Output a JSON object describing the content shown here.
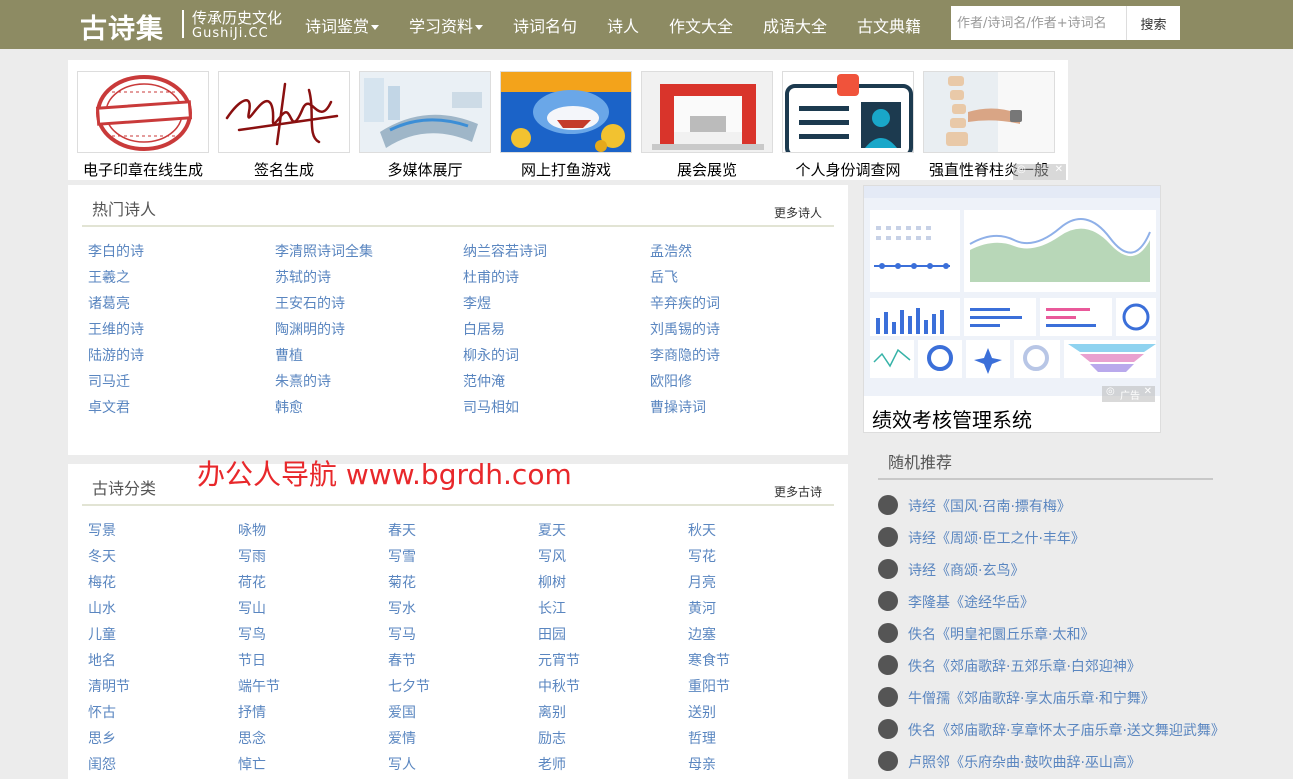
{
  "header": {
    "logo": "古诗集",
    "slogan": "传承历史文化",
    "domain": "GushiJi.CC",
    "nav": [
      "诗词鉴赏",
      "学习资料",
      "诗词名句",
      "诗人",
      "作文大全",
      "成语大全",
      "古文典籍"
    ],
    "search_placeholder": "作者/诗词名/作者+诗词名",
    "search_button": "搜索"
  },
  "ads": {
    "tiles": [
      "电子印章在线生成",
      "签名生成",
      "多媒体展厅",
      "网上打鱼游戏",
      "展会展览",
      "个人身份调查网",
      "强直性脊柱炎一般"
    ],
    "mark_label": "广告",
    "side_caption": "绩效考核管理系统"
  },
  "poets": {
    "title": "热门诗人",
    "more": "更多诗人",
    "items": [
      "李白的诗",
      "李清照诗词全集",
      "纳兰容若诗词",
      "孟浩然",
      "王羲之",
      "苏轼的诗",
      "杜甫的诗",
      "岳飞",
      "诸葛亮",
      "王安石的诗",
      "李煜",
      "辛弃疾的词",
      "王维的诗",
      "陶渊明的诗",
      "白居易",
      "刘禹锡的诗",
      "陆游的诗",
      "曹植",
      "柳永的词",
      "李商隐的诗",
      "司马迁",
      "朱熹的诗",
      "范仲淹",
      "欧阳修",
      "卓文君",
      "韩愈",
      "司马相如",
      "曹操诗词"
    ]
  },
  "categories": {
    "title": "古诗分类",
    "more": "更多古诗",
    "items": [
      "写景",
      "咏物",
      "春天",
      "夏天",
      "秋天",
      "冬天",
      "写雨",
      "写雪",
      "写风",
      "写花",
      "梅花",
      "荷花",
      "菊花",
      "柳树",
      "月亮",
      "山水",
      "写山",
      "写水",
      "长江",
      "黄河",
      "儿童",
      "写鸟",
      "写马",
      "田园",
      "边塞",
      "地名",
      "节日",
      "春节",
      "元宵节",
      "寒食节",
      "清明节",
      "端午节",
      "七夕节",
      "中秋节",
      "重阳节",
      "怀古",
      "抒情",
      "爱国",
      "离别",
      "送别",
      "思乡",
      "思念",
      "爱情",
      "励志",
      "哲理",
      "闺怨",
      "悼亡",
      "写人",
      "老师",
      "母亲"
    ]
  },
  "watermark": "办公人导航  www.bgrdh.com",
  "random": {
    "title": "随机推荐",
    "items": [
      "诗经《国风·召南·摽有梅》",
      "诗经《周颂·臣工之什·丰年》",
      "诗经《商颂·玄鸟》",
      "李隆基《途经华岳》",
      "佚名《明皇祀圜丘乐章·太和》",
      "佚名《郊庙歌辞·五郊乐章·白郊迎神》",
      "牛僧孺《郊庙歌辞·享太庙乐章·和宁舞》",
      "佚名《郊庙歌辞·享章怀太子庙乐章·送文舞迎武舞》",
      "卢照邻《乐府杂曲·鼓吹曲辞·巫山高》"
    ]
  },
  "colors": {
    "header_bg": "#8d8b63",
    "link": "#5a86c0",
    "watermark": "#e8282b"
  }
}
